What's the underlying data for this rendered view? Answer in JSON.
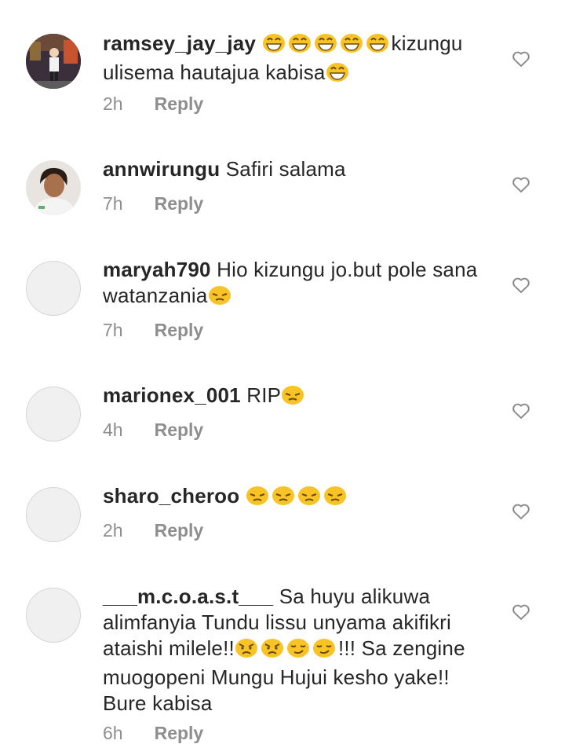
{
  "comments": [
    {
      "username": "ramsey_jay_jay",
      "emoji_before": [
        "grinning-face-with-sweat",
        "grinning-face-with-sweat",
        "grinning-face-with-sweat",
        "grinning-face-with-sweat",
        "grinning-face-with-sweat"
      ],
      "text": "kizungu ulisema hautajua kabisa",
      "emoji_after": [
        "grinning-face-with-sweat"
      ],
      "time": "2h",
      "reply": "Reply",
      "avatar": "profile-photo"
    },
    {
      "username": "annwirungu",
      "text": "Safiri salama",
      "time": "7h",
      "reply": "Reply",
      "avatar": "profile-photo"
    },
    {
      "username": "maryah790",
      "text": "Hio kizungu jo.but pole sana watanzania",
      "emoji_after": [
        "pensive-face"
      ],
      "time": "7h",
      "reply": "Reply",
      "avatar": "default"
    },
    {
      "username": "marionex_001",
      "text": "RIP",
      "emoji_after": [
        "pensive-face"
      ],
      "time": "4h",
      "reply": "Reply",
      "avatar": "default"
    },
    {
      "username": "sharo_cheroo",
      "text": "",
      "emoji_after": [
        "pensive-face",
        "pensive-face",
        "pensive-face",
        "pensive-face"
      ],
      "time": "2h",
      "reply": "Reply",
      "avatar": "default"
    },
    {
      "username": "___m.c.o.a.s.t___",
      "text_part1": "Sa huyu alikuwa alimfanyia Tundu lissu unyama akifikri ataishi milele!!",
      "emoji_mid": [
        "angry-face",
        "angry-face",
        "smirking-face",
        "smirking-face"
      ],
      "text_part2": "!!! Sa zengine muogopeni Mungu Hujui kesho yake!! Bure kabisa",
      "time": "6h",
      "reply": "Reply",
      "avatar": "default"
    }
  ],
  "colors": {
    "text": "#262626",
    "meta": "#8e8e8e",
    "emoji": "#f7c325"
  }
}
